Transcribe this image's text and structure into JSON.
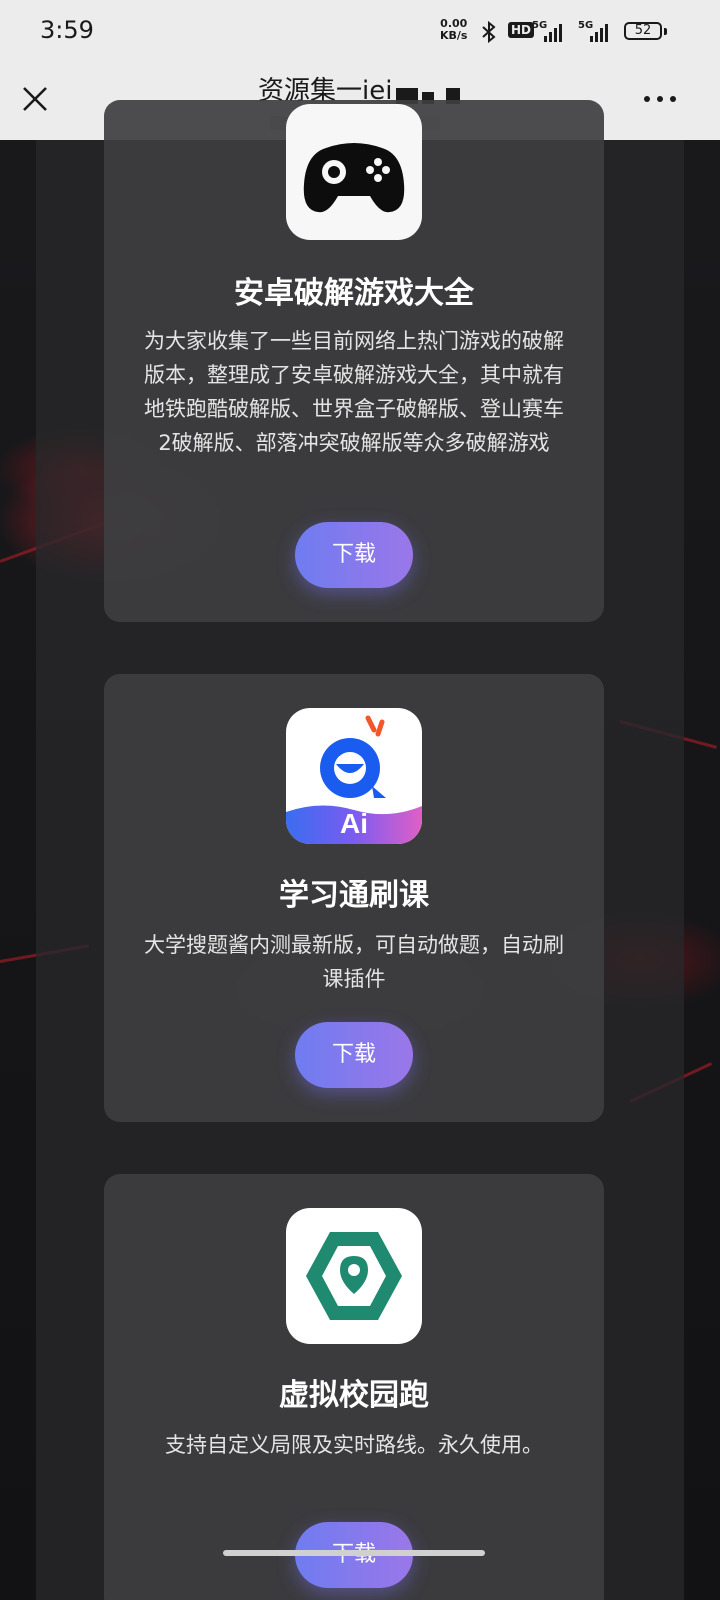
{
  "status_bar": {
    "time": "3:59",
    "net_speed_value": "0.00",
    "net_speed_unit": "KB/s",
    "hd_label": "HD",
    "signal1_label": "5G",
    "signal2_label": "5G",
    "battery": "52"
  },
  "nav": {
    "title": "资源集一iei"
  },
  "cards": [
    {
      "icon": "gamepad-icon",
      "title": "安卓破解游戏大全",
      "description": "为大家收集了一些目前网络上热门游戏的破解版本，整理成了安卓破解游戏大全，其中就有地铁跑酷破解版、世界盒子破解版、登山赛车2破解版、部落冲突破解版等众多破解游戏",
      "button": "下载"
    },
    {
      "icon": "xuexitong-ai-icon",
      "title": "学习通刷课",
      "description": "大学搜题酱内测最新版，可自动做题，自动刷课插件",
      "button": "下载",
      "icon_text": "Ai"
    },
    {
      "icon": "location-pin-hexagon-icon",
      "title": "虚拟校园跑",
      "description": "支持自定义局限及实时路线。永久使用。",
      "button": "下载"
    }
  ],
  "colors": {
    "button_gradient_start": "#6f7cf0",
    "button_gradient_end": "#9a77e9",
    "card_bg": "#3e3e40",
    "accent_red": "#c81e28",
    "campus_green": "#1f8a70"
  }
}
